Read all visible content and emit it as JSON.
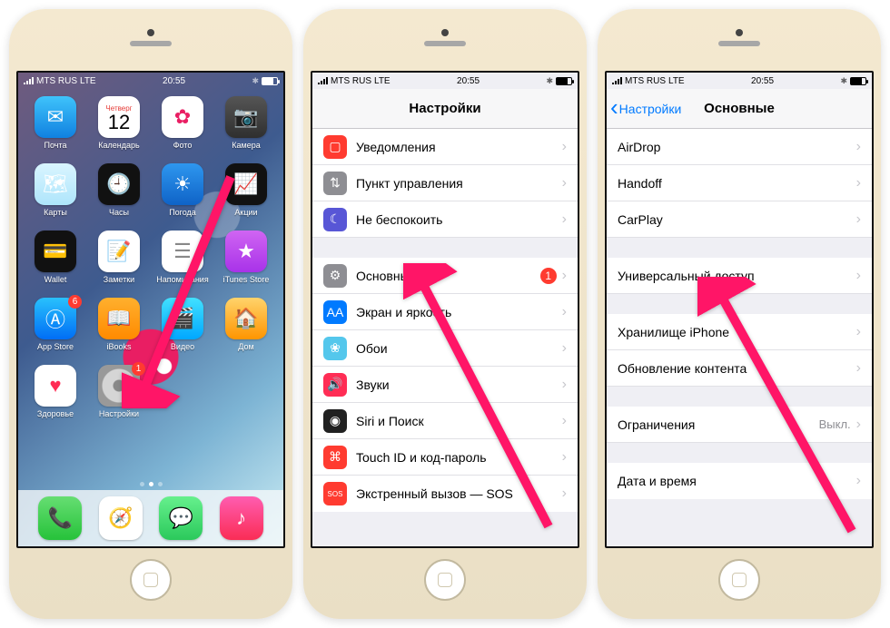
{
  "status": {
    "carrier": "MTS RUS",
    "net": "LTE",
    "time": "20:55"
  },
  "phone1": {
    "apps": [
      {
        "label": "Почта",
        "bg": "linear-gradient(#3fc3fb,#1081e0)",
        "glyph": "✉"
      },
      {
        "label": "Календарь",
        "type": "cal",
        "dow": "Четверг",
        "day": "12"
      },
      {
        "label": "Фото",
        "bg": "#fff",
        "glyph": "✿",
        "fg": "#e91e63"
      },
      {
        "label": "Камера",
        "bg": "linear-gradient(#555,#2f2f2f)",
        "glyph": "📷"
      },
      {
        "label": "Карты",
        "bg": "linear-gradient(#d9f5ff,#aee5fb)",
        "glyph": "🗺"
      },
      {
        "label": "Часы",
        "bg": "#111",
        "glyph": "🕘"
      },
      {
        "label": "Погода",
        "bg": "linear-gradient(#2e97ef,#0f63c7)",
        "glyph": "☀"
      },
      {
        "label": "Акции",
        "bg": "#111",
        "glyph": "📈"
      },
      {
        "label": "Wallet",
        "bg": "#111",
        "glyph": "💳"
      },
      {
        "label": "Заметки",
        "bg": "#fff",
        "glyph": "📝",
        "fg": "#f4c95d"
      },
      {
        "label": "Напоминания",
        "bg": "#fff",
        "glyph": "☰",
        "fg": "#888"
      },
      {
        "label": "iTunes Store",
        "bg": "linear-gradient(#d065f2,#a832e9)",
        "glyph": "★"
      },
      {
        "label": "App Store",
        "bg": "linear-gradient(#29c1fd,#006ef5)",
        "glyph": "Ⓐ",
        "badge": "6"
      },
      {
        "label": "iBooks",
        "bg": "linear-gradient(#ffb02e,#ff8a00)",
        "glyph": "📖"
      },
      {
        "label": "Видео",
        "bg": "linear-gradient(#42e1ff,#00a7ff)",
        "glyph": "🎬"
      },
      {
        "label": "Дом",
        "bg": "linear-gradient(#ffd36b,#ff9500)",
        "glyph": "🏠"
      },
      {
        "label": "Здоровье",
        "bg": "#fff",
        "glyph": "♥",
        "fg": "#ff2d55"
      },
      {
        "label": "Настройки",
        "type": "settings",
        "badge": "1"
      }
    ],
    "dock": [
      {
        "bg": "linear-gradient(#66de72,#26c23a)",
        "glyph": "📞"
      },
      {
        "bg": "#fff",
        "glyph": "🧭",
        "fg": "#1385ff"
      },
      {
        "bg": "linear-gradient(#66f08d,#2bc95b)",
        "glyph": "💬"
      },
      {
        "bg": "linear-gradient(#ff5db0,#fa2d55)",
        "glyph": "♪"
      }
    ]
  },
  "phone2": {
    "title": "Настройки",
    "group1": [
      {
        "label": "Уведомления",
        "icon_bg": "#ff3b30",
        "glyph": "▢"
      },
      {
        "label": "Пункт управления",
        "icon_bg": "#8e8e93",
        "glyph": "⇅"
      },
      {
        "label": "Не беспокоить",
        "icon_bg": "#5856d6",
        "glyph": "☾"
      }
    ],
    "group2": [
      {
        "label": "Основные",
        "icon_bg": "#8e8e93",
        "glyph": "⚙",
        "badge": "1"
      },
      {
        "label": "Экран и яркость",
        "icon_bg": "#007aff",
        "glyph": "AA"
      },
      {
        "label": "Обои",
        "icon_bg": "#54c7ec",
        "glyph": "❀"
      },
      {
        "label": "Звуки",
        "icon_bg": "#ff2d55",
        "glyph": "🔊"
      },
      {
        "label": "Siri и Поиск",
        "icon_bg": "#212121",
        "glyph": "◉"
      },
      {
        "label": "Touch ID и код-пароль",
        "icon_bg": "#ff3b30",
        "glyph": "⌘"
      },
      {
        "label": "Экстренный вызов — SOS",
        "icon_bg": "#ff3b30",
        "glyph": "SOS",
        "small": true
      }
    ]
  },
  "phone3": {
    "back": "Настройки",
    "title": "Основные",
    "group1": [
      {
        "label": "AirDrop"
      },
      {
        "label": "Handoff"
      },
      {
        "label": "CarPlay"
      }
    ],
    "group2": [
      {
        "label": "Универсальный доступ"
      }
    ],
    "group3": [
      {
        "label": "Хранилище iPhone"
      },
      {
        "label": "Обновление контента"
      }
    ],
    "group4": [
      {
        "label": "Ограничения",
        "value": "Выкл."
      }
    ],
    "group5": [
      {
        "label": "Дата и время"
      }
    ]
  },
  "arrow_color": "#ff1567"
}
